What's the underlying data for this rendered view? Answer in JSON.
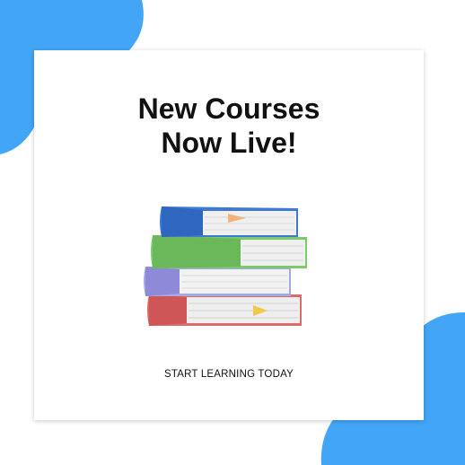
{
  "headline": {
    "line1": "New Courses",
    "line2": "Now Live!"
  },
  "cta": {
    "label": "START LEARNING TODAY"
  },
  "colors": {
    "blob_dark": "#42a5f5",
    "blob_light": "#90caf9",
    "card_background": "#ffffff",
    "text": "#111111",
    "book_blue": "#3f79d6",
    "book_green": "#7ccb6a",
    "book_lavender": "#a9a6e6",
    "book_red": "#e06a6a",
    "bookmark": "#f2b27a"
  },
  "illustration": {
    "icon": "stack-of-books-icon"
  }
}
